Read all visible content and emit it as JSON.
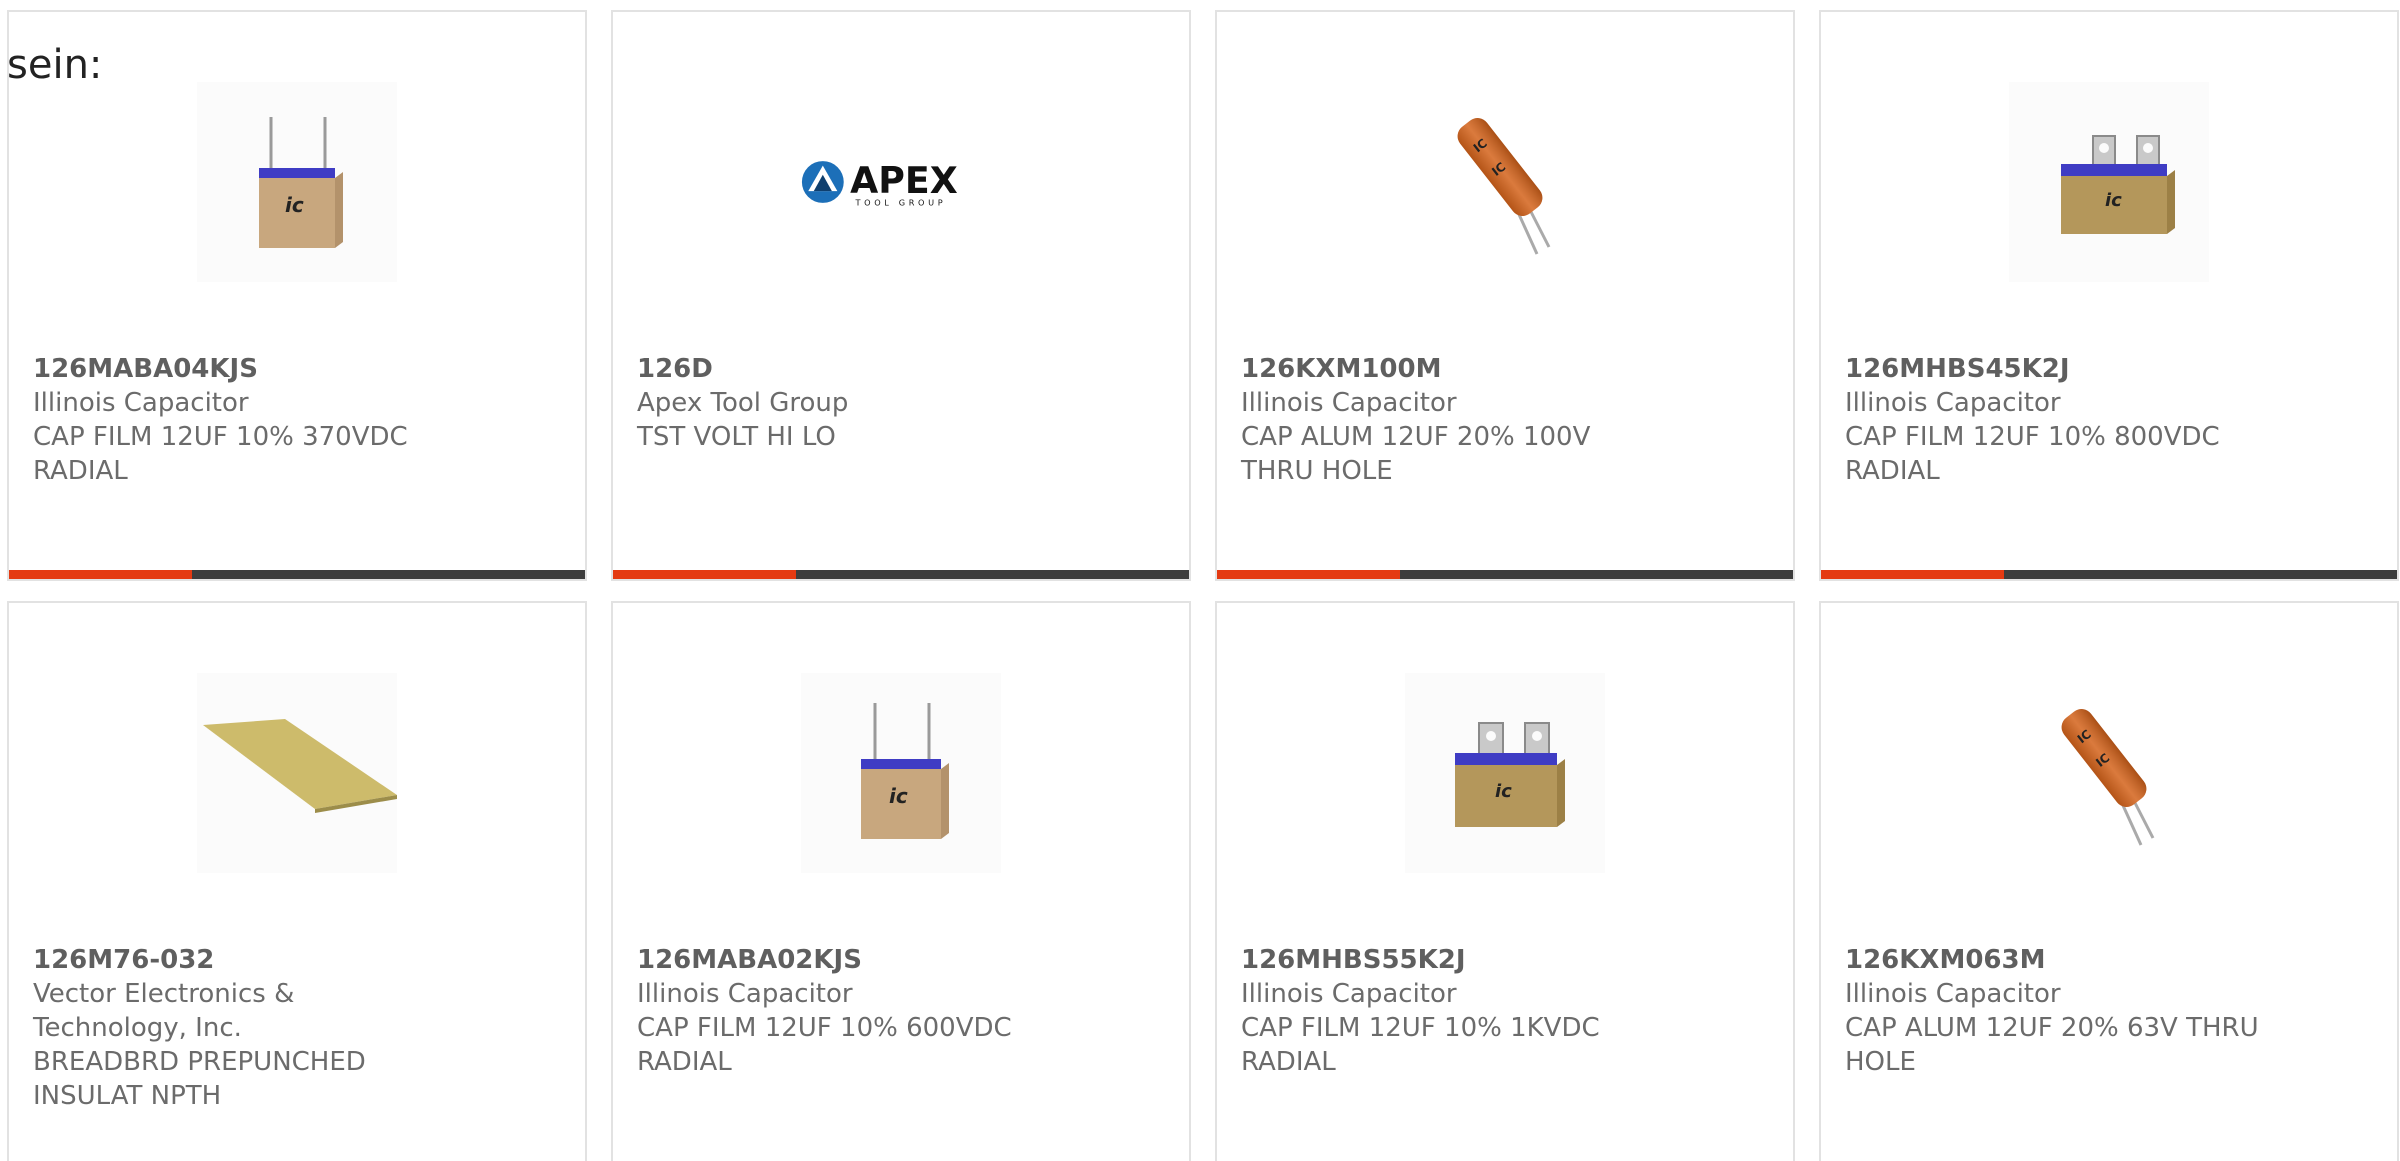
{
  "intro": {
    "text": "sein:"
  },
  "products": [
    {
      "part": "126MABA04KJS",
      "manufacturer": "Illinois Capacitor",
      "description": "CAP FILM 12UF 10% 370VDC RADIAL",
      "image": "box-capacitor-radial-icon"
    },
    {
      "part": "126D",
      "manufacturer": "Apex Tool Group",
      "description": "TST VOLT HI LO",
      "image": "apex-logo",
      "logo": {
        "name": "APEX",
        "tagline": "TOOL GROUP"
      }
    },
    {
      "part": "126KXM100M",
      "manufacturer": "Illinois Capacitor",
      "description": "CAP ALUM 12UF 20% 100V THRU HOLE",
      "image": "electrolytic-capacitor-icon"
    },
    {
      "part": "126MHBS45K2J",
      "manufacturer": "Illinois Capacitor",
      "description": "CAP FILM 12UF 10% 800VDC RADIAL",
      "image": "box-capacitor-tab-icon"
    },
    {
      "part": "126M76-032",
      "manufacturer": "Vector Electronics & Technology, Inc.",
      "description": "BREADBRD PREPUNCHED INSULAT NPTH",
      "image": "breadboard-icon"
    },
    {
      "part": "126MABA02KJS",
      "manufacturer": "Illinois Capacitor",
      "description": "CAP FILM 12UF 10% 600VDC RADIAL",
      "image": "box-capacitor-radial-icon"
    },
    {
      "part": "126MHBS55K2J",
      "manufacturer": "Illinois Capacitor",
      "description": "CAP FILM 12UF 10% 1KVDC RADIAL",
      "image": "box-capacitor-tab-icon"
    },
    {
      "part": "126KXM063M",
      "manufacturer": "Illinois Capacitor",
      "description": "CAP ALUM 12UF 20% 63V THRU HOLE",
      "image": "electrolytic-capacitor-icon"
    }
  ],
  "colors": {
    "accent": "#e43a12",
    "bar": "#3d3d3d",
    "border": "#e2e2e2",
    "text": "#6b6b6b"
  }
}
